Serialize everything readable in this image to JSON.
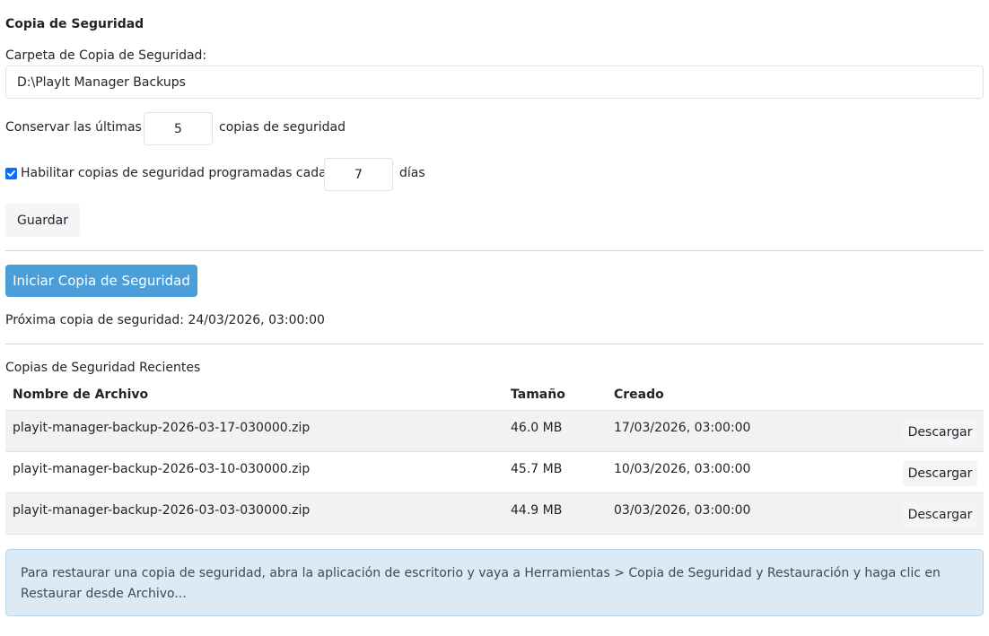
{
  "section_title": "Copia de Seguridad",
  "folder": {
    "label": "Carpeta de Copia de Seguridad:",
    "value": "D:\\PlayIt Manager Backups"
  },
  "retention": {
    "prefix": "Conservar las últimas",
    "value": "5",
    "suffix": "copias de seguridad"
  },
  "schedule": {
    "checked": true,
    "label": "Habilitar copias de seguridad programadas cada",
    "value": "7",
    "suffix": "días"
  },
  "save_label": "Guardar",
  "start_backup_label": "Iniciar Copia de Seguridad",
  "next_backup": "Próxima copia de seguridad: 24/03/2026, 03:00:00",
  "recent": {
    "title": "Copias de Seguridad Recientes",
    "columns": [
      "Nombre de Archivo",
      "Tamaño",
      "Creado"
    ],
    "rows": [
      {
        "name": "playit-manager-backup-2026-03-17-030000.zip",
        "size": "46.0 MB",
        "created": "17/03/2026, 03:00:00",
        "action": "Descargar"
      },
      {
        "name": "playit-manager-backup-2026-03-10-030000.zip",
        "size": "45.7 MB",
        "created": "10/03/2026, 03:00:00",
        "action": "Descargar"
      },
      {
        "name": "playit-manager-backup-2026-03-03-030000.zip",
        "size": "44.9 MB",
        "created": "03/03/2026, 03:00:00",
        "action": "Descargar"
      }
    ]
  },
  "info": "Para restaurar una copia de seguridad, abra la aplicación de escritorio y vaya a Herramientas > Copia de Seguridad y Restauración y haga clic en Restaurar desde Archivo...",
  "colors": {
    "primary_button": "#4a9ed9",
    "checkbox": "#0d6efd",
    "alert_bg": "#dbeaf5",
    "row_stripe": "#f2f2f2"
  }
}
